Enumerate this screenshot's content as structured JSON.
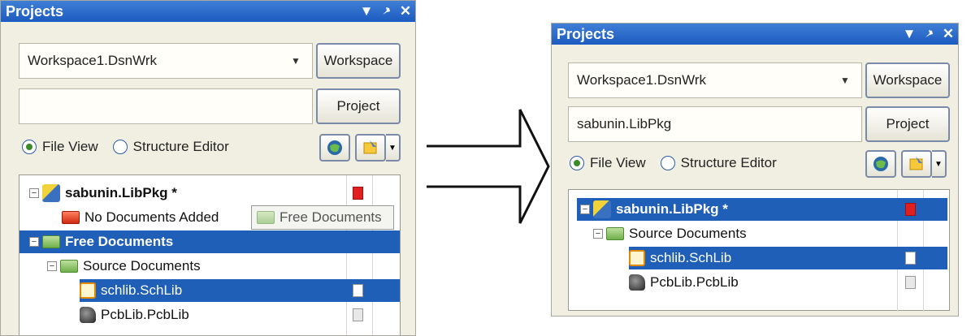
{
  "left_panel": {
    "title": "Projects",
    "workspace_combo": "Workspace1.DsnWrk",
    "workspace_button": "Workspace",
    "project_field": "",
    "project_button": "Project",
    "radio_file_view": "File View",
    "radio_structure_editor": "Structure Editor",
    "tree": {
      "project": "sabunin.LibPkg *",
      "no_docs": "No Documents Added",
      "free_docs": "Free Documents",
      "source_docs": "Source Documents",
      "schlib": "schlib.SchLib",
      "pcblib": "PcbLib.PcbLib"
    },
    "drag_tooltip": "Free Documents"
  },
  "right_panel": {
    "title": "Projects",
    "workspace_combo": "Workspace1.DsnWrk",
    "workspace_button": "Workspace",
    "project_field": "sabunin.LibPkg",
    "project_button": "Project",
    "radio_file_view": "File View",
    "radio_structure_editor": "Structure Editor",
    "tree": {
      "project": "sabunin.LibPkg *",
      "source_docs": "Source Documents",
      "schlib": "schlib.SchLib",
      "pcblib": "PcbLib.PcbLib"
    }
  },
  "icons": {
    "dropdown": "▼",
    "pin": "pin-icon",
    "close": "✕",
    "combo_arrow": "▼"
  },
  "colors": {
    "title_bar": "#1c5bc0",
    "selection": "#1f5fb8",
    "panel_bg": "#f1efe2"
  }
}
